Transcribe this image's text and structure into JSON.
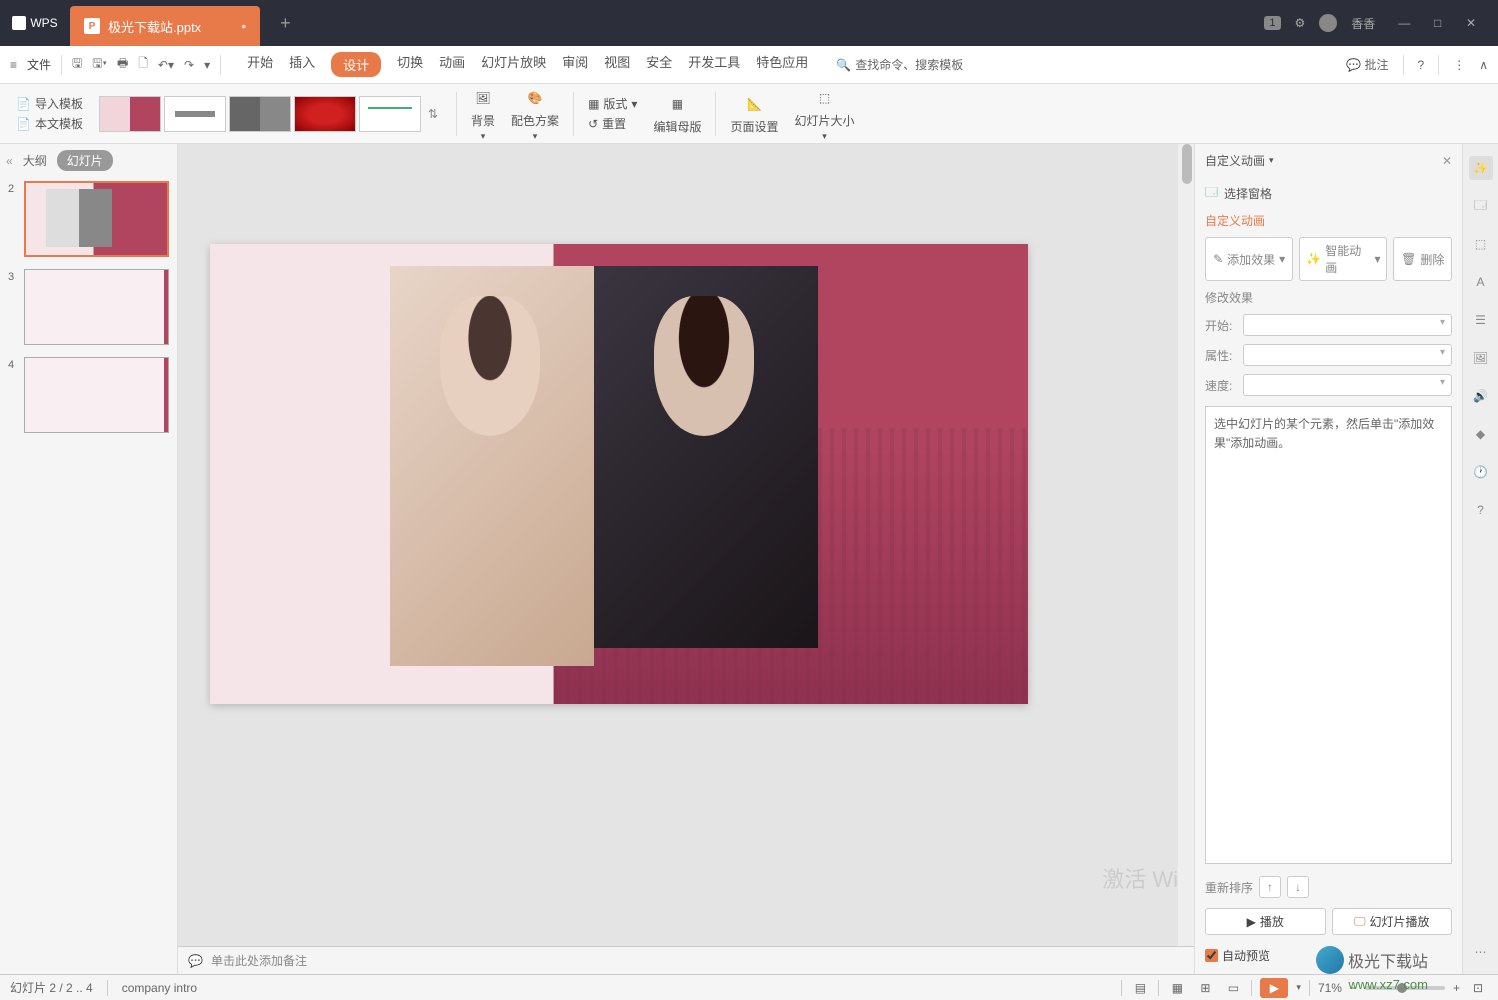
{
  "titlebar": {
    "app": "WPS",
    "tab_name": "极光下载站.pptx",
    "badge": "1",
    "username": "香香"
  },
  "menubar": {
    "file": "文件",
    "tabs": [
      "开始",
      "插入",
      "设计",
      "切换",
      "动画",
      "幻灯片放映",
      "审阅",
      "视图",
      "安全",
      "开发工具",
      "特色应用"
    ],
    "active_tab": "设计",
    "search_placeholder": "查找命令、搜索模板",
    "comments": "批注"
  },
  "ribbon": {
    "import_template": "导入模板",
    "this_template": "本文模板",
    "background": "背景",
    "color_scheme": "配色方案",
    "layout": "版式",
    "reset": "重置",
    "edit_master": "编辑母版",
    "page_setup": "页面设置",
    "slide_size": "幻灯片大小"
  },
  "left_pane": {
    "outline": "大纲",
    "slides": "幻灯片",
    "thumbs": [
      {
        "num": "2",
        "selected": true
      },
      {
        "num": "3",
        "selected": false
      },
      {
        "num": "4",
        "selected": false
      }
    ]
  },
  "canvas": {
    "notes_placeholder": "单击此处添加备注"
  },
  "animation_pane": {
    "title": "自定义动画",
    "select_pane": "选择窗格",
    "section": "自定义动画",
    "add_effect": "添加效果",
    "smart_anim": "智能动画",
    "delete": "删除",
    "modify_effect": "修改效果",
    "start_label": "开始:",
    "property_label": "属性:",
    "speed_label": "速度:",
    "hint": "选中幻灯片的某个元素，然后单击\"添加效果\"添加动画。",
    "reorder": "重新排序",
    "play": "播放",
    "slideshow_play": "幻灯片播放",
    "auto_preview": "自动预览"
  },
  "statusbar": {
    "slide_info": "幻灯片 2 / 2 .. 4",
    "company": "company intro",
    "zoom": "71%",
    "activate": "激活 Wi",
    "logo_text": "极光下载站",
    "url": "www.xz7.com"
  }
}
